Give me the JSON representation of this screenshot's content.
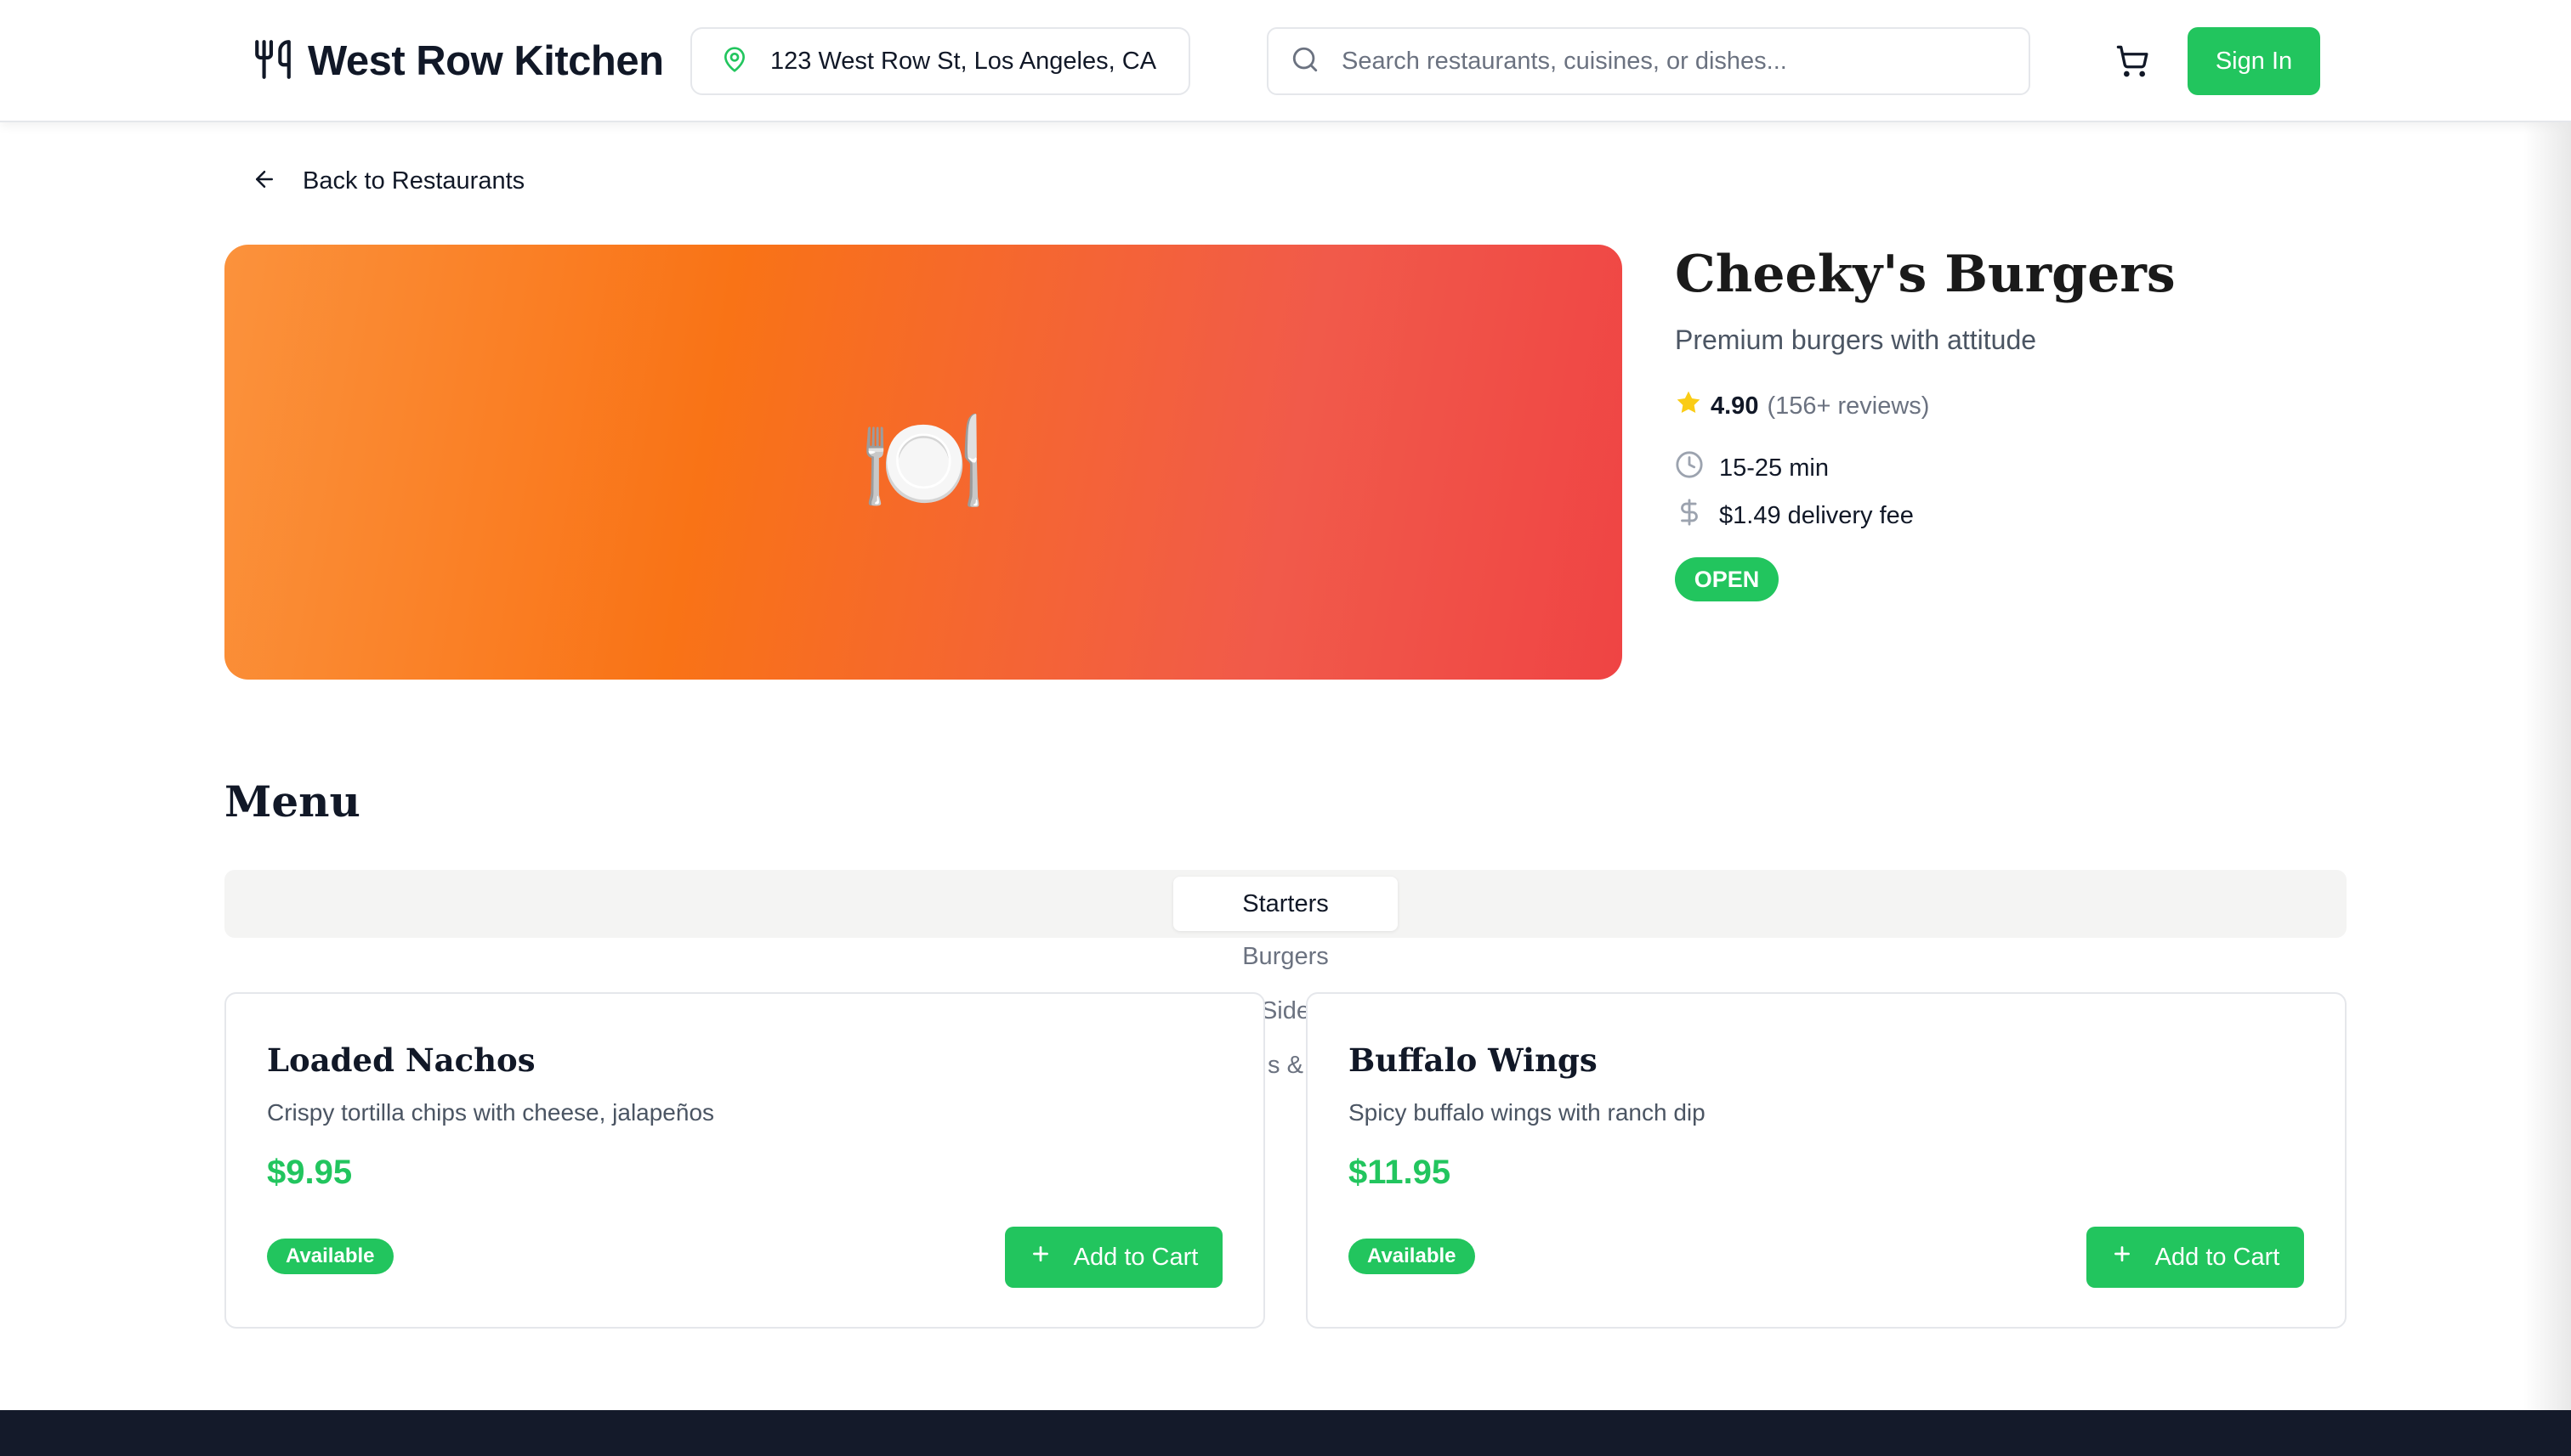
{
  "header": {
    "brand": "West Row Kitchen",
    "location": "123 West Row St, Los Angeles, CA",
    "search_placeholder": "Search restaurants, cuisines, or dishes...",
    "signin_label": "Sign In"
  },
  "nav": {
    "back_label": "Back to Restaurants"
  },
  "restaurant": {
    "hero_icon": "🍽️",
    "name": "Cheeky's Burgers",
    "tagline": "Premium burgers with attitude",
    "rating": "4.90",
    "reviews": "(156+ reviews)",
    "delivery_time": "15-25 min",
    "delivery_fee": "$1.49 delivery fee",
    "status": "OPEN"
  },
  "menu": {
    "title": "Menu",
    "tabs": [
      {
        "label": "Starters",
        "active": true
      },
      {
        "label": "Burgers",
        "active": false
      },
      {
        "label": "Side",
        "active": false
      },
      {
        "label": "s &",
        "active": false
      }
    ],
    "items": [
      {
        "name": "Loaded Nachos",
        "description": "Crispy tortilla chips with cheese, jalapeños",
        "price": "$9.95",
        "availability": "Available",
        "button_label": "Add to Cart"
      },
      {
        "name": "Buffalo Wings",
        "description": "Spicy buffalo wings with ranch dip",
        "price": "$11.95",
        "availability": "Available",
        "button_label": "Add to Cart"
      }
    ]
  },
  "colors": {
    "accent": "#22c55e",
    "hero_start": "#fb923c",
    "hero_end": "#ef4444",
    "star": "#facc15",
    "footer": "#141a2a"
  },
  "icons": {
    "logo": "utensils-icon",
    "location": "map-pin-icon",
    "search": "search-icon",
    "cart": "shopping-cart-icon",
    "back": "arrow-left-icon",
    "star": "star-icon",
    "time": "clock-icon",
    "fee": "dollar-icon",
    "add": "plus-icon"
  }
}
